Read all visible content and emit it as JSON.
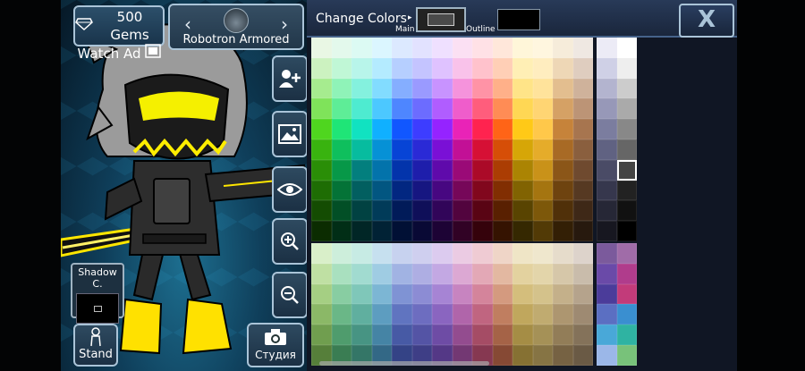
{
  "top": {
    "gems_label": "500 Gems",
    "watch_ad_label": "Watch Ad",
    "character_name": "Robotron Armored"
  },
  "tools": {
    "shadow_label": "Shadow C.",
    "stand_label": "Stand",
    "studio_label": "Студия"
  },
  "panel": {
    "title": "Change Colors",
    "main_label": "Main",
    "outline_label": "Outline",
    "close_label": "X",
    "main_color": "#4a4a4a",
    "outline_color": "#000000",
    "selected_color": "#888888"
  },
  "palette": {
    "top_rows": [
      [
        "#e9f7e4",
        "#e3f9ec",
        "#dcfaf3",
        "#dbf6ff",
        "#dce9ff",
        "#e2e2ff",
        "#efe0ff",
        "#fbe0f3",
        "#ffe1e6",
        "#ffe7da",
        "#fff6d9",
        "#fff6df",
        "#f6ecda",
        "#efe8e2",
        "#ecebf6",
        "#ffffff"
      ],
      [
        "#ccf2c0",
        "#c0f7d6",
        "#b8f5ea",
        "#b4ebff",
        "#b6cfff",
        "#c4c4ff",
        "#dfc2ff",
        "#f9c2ea",
        "#ffc2cc",
        "#ffcfb6",
        "#ffefb5",
        "#ffedbf",
        "#eed7b6",
        "#dfcdbf",
        "#cfd0e6",
        "#eeeeee"
      ],
      [
        "#a6ec8f",
        "#8ff3b8",
        "#84f1de",
        "#82dcff",
        "#85aeff",
        "#9a9aff",
        "#c893ff",
        "#f593dc",
        "#ff93a6",
        "#ffb089",
        "#ffe488",
        "#ffe39b",
        "#e3be8f",
        "#cfb29b",
        "#b3b4cf",
        "#cccccc"
      ],
      [
        "#7fe35a",
        "#5eed97",
        "#4eebd0",
        "#4cc8ff",
        "#4e86ff",
        "#6c6cff",
        "#b05dff",
        "#ef5dcb",
        "#ff5d7c",
        "#ff8c55",
        "#ffd754",
        "#ffd573",
        "#d5a165",
        "#bc9476",
        "#9798b8",
        "#aaaaaa"
      ],
      [
        "#4fd61f",
        "#1fe577",
        "#11e2c1",
        "#10b0ff",
        "#1157ff",
        "#3d3dff",
        "#9523ff",
        "#e923b7",
        "#ff234f",
        "#ff6417",
        "#ffc917",
        "#ffc84a",
        "#c6833a",
        "#a7754f",
        "#7b7d9f",
        "#888888"
      ],
      [
        "#39b30f",
        "#0fbf5d",
        "#07bc9f",
        "#0691d6",
        "#0744d6",
        "#2a2ad6",
        "#7a10d6",
        "#c21096",
        "#d61035",
        "#d64e07",
        "#d6a607",
        "#e5ac2a",
        "#a86a25",
        "#8a5f3e",
        "#606282",
        "#666666"
      ],
      [
        "#2a8e07",
        "#079848",
        "#037f7e",
        "#0373ab",
        "#0334ab",
        "#1e1eab",
        "#5f0aab",
        "#9a0a77",
        "#ab0a28",
        "#ab3d03",
        "#ab8403",
        "#c99219",
        "#8b5618",
        "#6f4a2f",
        "#4a4b66",
        "#444444"
      ],
      [
        "#1e6d04",
        "#047337",
        "#025f60",
        "#025681",
        "#022781",
        "#161681",
        "#470781",
        "#760759",
        "#81071d",
        "#812e02",
        "#816302",
        "#a57510",
        "#6e430f",
        "#563922",
        "#36374d",
        "#222222"
      ],
      [
        "#144c02",
        "#024f26",
        "#014242",
        "#013b59",
        "#011b59",
        "#0f0f59",
        "#310559",
        "#52043e",
        "#590414",
        "#592001",
        "#594401",
        "#7d580a",
        "#503009",
        "#3e2817",
        "#262736",
        "#111111"
      ],
      [
        "#0b2c01",
        "#012e16",
        "#012626",
        "#012235",
        "#011035",
        "#090935",
        "#1d0335",
        "#310225",
        "#35020b",
        "#351301",
        "#352801",
        "#523a06",
        "#331f05",
        "#27190e",
        "#171720",
        "#000000"
      ]
    ],
    "bottom_rows": [
      [
        "#d9efc9",
        "#cdeedb",
        "#c7ebe4",
        "#c6e0ef",
        "#c7d2ef",
        "#cfcfef",
        "#dccbef",
        "#ebcbe3",
        "#efcbd3",
        "#efd5c7",
        "#efe5c6",
        "#efe7cd",
        "#e6dccb",
        "#ddd3cb",
        "#7b5a9c",
        "#a06ca8"
      ],
      [
        "#bfe0a3",
        "#a9e0bf",
        "#a1dbd0",
        "#9fcce3",
        "#a1b3e3",
        "#aeaee3",
        "#c3a8e3",
        "#dca8d3",
        "#e3a8b6",
        "#e3b8a1",
        "#e3d29f",
        "#e3d5aa",
        "#d6c7a9",
        "#c9bcab",
        "#6a4aa8",
        "#b03c8c"
      ],
      [
        "#a5cf83",
        "#88cda2",
        "#7fc7b9",
        "#7cb6d4",
        "#7f93d4",
        "#8c8cd4",
        "#a684d4",
        "#c784c0",
        "#d4849b",
        "#d49a7f",
        "#d4be7c",
        "#d4c28b",
        "#c4b08a",
        "#b5a38c",
        "#4b3c9a",
        "#c23b7a"
      ],
      [
        "#8bb867",
        "#6ab787",
        "#60af9f",
        "#5d9dc0",
        "#6074c0",
        "#6d6dc0",
        "#8a65c0",
        "#b065aa",
        "#c06580",
        "#c07e60",
        "#c0a75d",
        "#c0ab70",
        "#ad9670",
        "#9e8a72",
        "#5b6fc2",
        "#3a8fd0"
      ],
      [
        "#709e4f",
        "#4f9c6d",
        "#479483",
        "#4584a5",
        "#475aa5",
        "#5454a5",
        "#6e4ca5",
        "#934c8f",
        "#a54c65",
        "#a56347",
        "#a58d45",
        "#a59157",
        "#927d58",
        "#84725a",
        "#49a8d8",
        "#2fb3a2"
      ],
      [
        "#567f3a",
        "#3a7d53",
        "#347667",
        "#336886",
        "#344386",
        "#3e3e86",
        "#543886",
        "#733873",
        "#863851",
        "#864934",
        "#867133",
        "#867444",
        "#766243",
        "#6a5a45",
        "#9bb7e8",
        "#78c27a"
      ]
    ]
  }
}
